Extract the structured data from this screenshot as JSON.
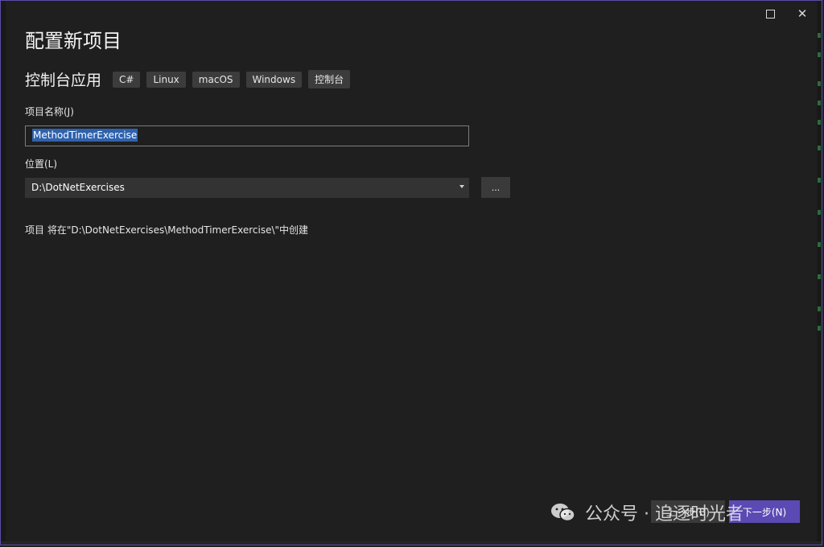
{
  "window": {
    "maximize_icon": "maximize-icon",
    "close_glyph": "✕"
  },
  "page": {
    "title": "配置新项目",
    "template_name": "控制台应用",
    "tags": [
      "C#",
      "Linux",
      "macOS",
      "Windows",
      "控制台"
    ]
  },
  "project_name": {
    "label": "项目名称(J)",
    "value": "MethodTimerExercise"
  },
  "location": {
    "label": "位置(L)",
    "value": "D:\\DotNetExercises",
    "browse_label": "..."
  },
  "info": {
    "text": "项目 将在\"D:\\DotNetExercises\\MethodTimerExercise\\\"中创建"
  },
  "footer": {
    "back_label": "上一步(B)",
    "next_label": "下一步(N)"
  },
  "watermark": {
    "text": "公众号 · 追逐时光者"
  },
  "colors": {
    "accent": "#5b4ab4",
    "selection": "#2f62ad",
    "background": "#1f1f1f"
  }
}
